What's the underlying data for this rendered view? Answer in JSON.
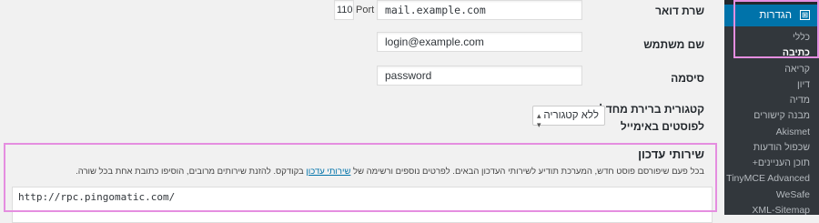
{
  "form": {
    "mail_server": {
      "label": "שרת דואר",
      "value": "mail.example.com",
      "port_label": "Port",
      "port_value": "110"
    },
    "username": {
      "label": "שם משתמש",
      "value": "login@example.com"
    },
    "password": {
      "label": "סיסמה",
      "value": "password"
    },
    "category": {
      "label": "קטגורית ברירת מחדל לפוסטים באימייל",
      "selected": "ללא קטגוריה"
    }
  },
  "update_services": {
    "title": "שירותי עדכון",
    "desc_before": "בכל פעם שיפורסם פוסט חדש, המערכת תודיע לשירותי העדכון הבאים. לפרטים נוספים ורשימה של",
    "desc_link": "שירותי עדכון",
    "desc_after": "בקודקס. להזנת שירותים מרובים, הוסיפו כתובת אחת בכל שורה.",
    "textarea_value": "http://rpc.pingomatic.com/"
  },
  "sidebar": {
    "menu_label": "הגדרות",
    "menu_icon_glyph": "⊞",
    "items": [
      {
        "label": "כללי"
      },
      {
        "label": "כתיבה"
      },
      {
        "label": "קריאה"
      },
      {
        "label": "דיון"
      },
      {
        "label": "מדיה"
      },
      {
        "label": "מבנה קישורים"
      },
      {
        "label": "Akismet"
      },
      {
        "label": "שכפול הודעות"
      },
      {
        "label": "תוכן העניינים+"
      },
      {
        "label": "TinyMCE Advanced"
      },
      {
        "label": "WeSafe"
      },
      {
        "label": "XML-Sitemap"
      }
    ]
  },
  "colors": {
    "accent": "#0073aa",
    "highlight": "#e58ee0",
    "sidebar": "#23282d"
  }
}
